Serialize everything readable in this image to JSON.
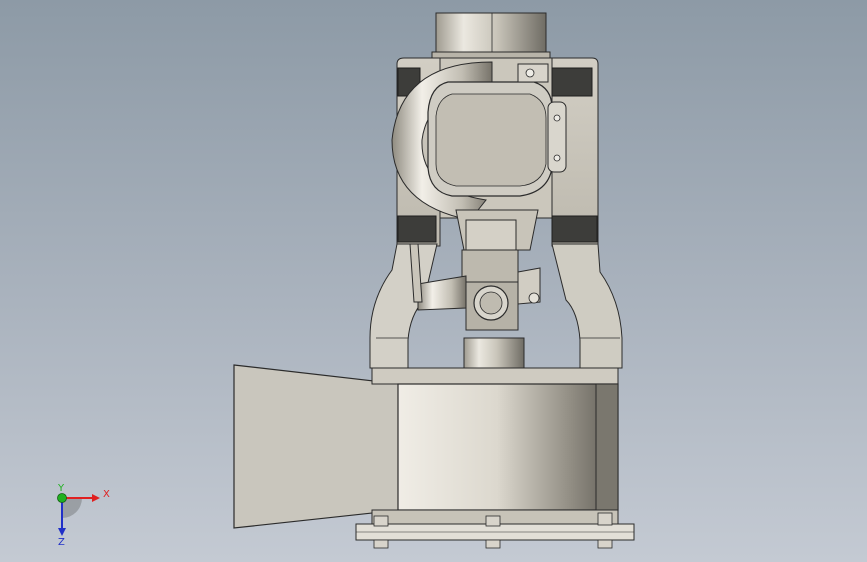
{
  "viewport": {
    "background_top": "#8d9aa6",
    "background_bottom": "#c4cad3"
  },
  "model": {
    "type": "robot-gripper-assembly",
    "edge_color": "#2b2b2b",
    "shade_light": "#e7e4dc",
    "shade_mid": "#bab6aa",
    "shade_dark": "#7f7b71",
    "band_color": "#3d3d3a"
  },
  "triad": {
    "x_label": "X",
    "y_label": "Y",
    "z_label": "Z",
    "x_color": "#e02020",
    "y_color": "#20b020",
    "z_color": "#2030c8"
  }
}
